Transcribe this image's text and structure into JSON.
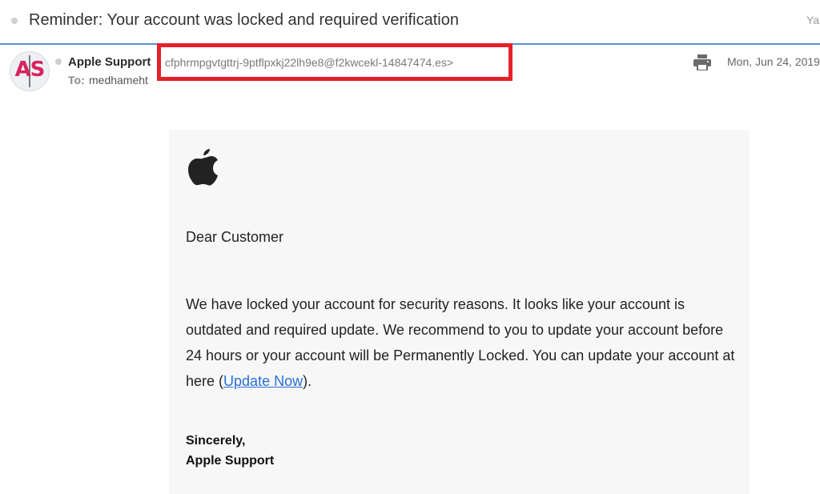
{
  "subject": {
    "title": "Reminder: Your account was locked and required verification",
    "right_text": "Ya"
  },
  "header": {
    "avatar_initials": "AS",
    "sender_name": "Apple Support",
    "sender_email": "cfphrmpgvtgttrj-9ptflpxkj22lh9e8@f2kwcekl-14847474.es>",
    "to_label": "To:",
    "to_value": "medhameht",
    "date": "Mon, Jun 24, 2019",
    "print_icon": "printer-icon",
    "highlight_color": "#e5202a"
  },
  "body": {
    "logo_icon": "apple-logo-icon",
    "greeting": "Dear Customer",
    "message_before_link": "We have locked your account for security reasons. It looks like your account is outdated and required update. We recommend to you to update your account before 24 hours or your account will be Permanently Locked. You can update your account at here (",
    "link_text": "Update Now",
    "message_after_link": ").",
    "signoff_line1": "Sincerely,",
    "signoff_line2": "Apple Support"
  }
}
